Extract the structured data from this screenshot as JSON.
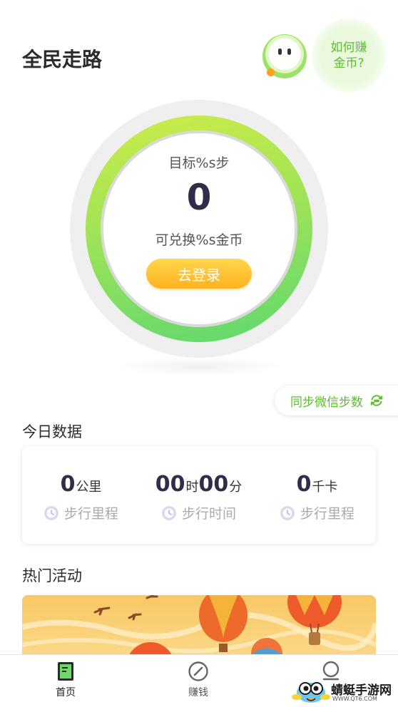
{
  "header": {
    "title": "全民走路",
    "earn_line1": "如何赚",
    "earn_line2": "金币?"
  },
  "ring": {
    "goal_text": "目标%s步",
    "step_count": "0",
    "exchange_text": "可兑换%s金币",
    "login_label": "去登录"
  },
  "sync": {
    "label": "同步微信步数"
  },
  "today": {
    "title": "今日数据",
    "stats": [
      {
        "value": "0",
        "unit": "公里",
        "label": "步行里程"
      },
      {
        "value": "00",
        "unit": "时",
        "value2": "00",
        "unit2": "分",
        "label": "步行时间"
      },
      {
        "value": "0",
        "unit": "千卡",
        "label": "步行里程"
      }
    ]
  },
  "activities": {
    "title": "热门活动"
  },
  "tabbar": {
    "tabs": [
      {
        "label": "首页"
      },
      {
        "label": "赚钱"
      },
      {
        "label": ""
      }
    ]
  },
  "watermark": {
    "text": "蜻蜓手游网",
    "url": "WWW.QT6.COM"
  },
  "colors": {
    "accent_green": "#5bbf2c",
    "login_orange": "#ffb21f",
    "ring_start": "#cdec49",
    "ring_end": "#5fd870"
  }
}
